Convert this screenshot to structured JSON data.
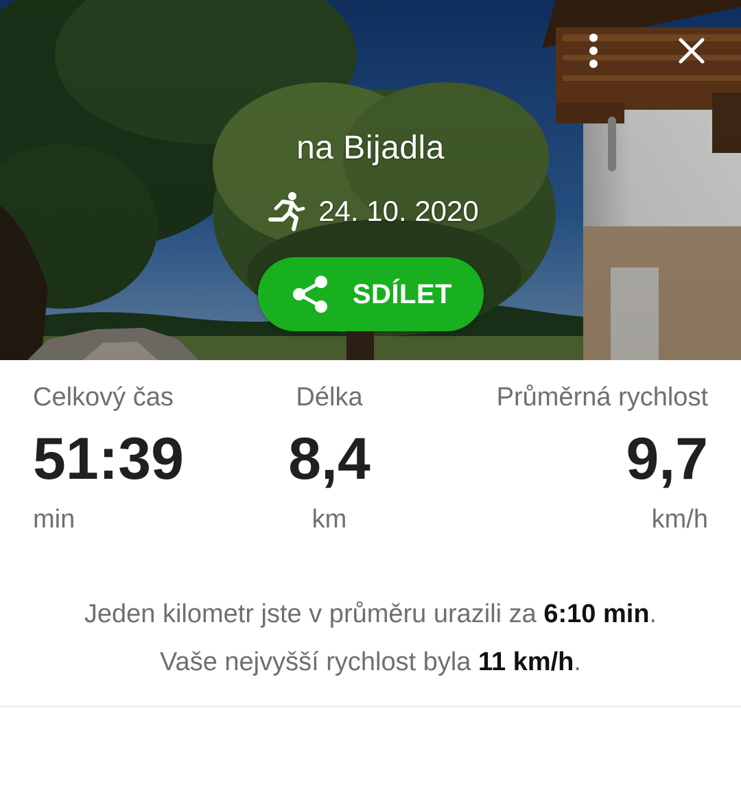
{
  "hero": {
    "title": "na Bijadla",
    "activity_icon": "running-person-icon",
    "date": "24. 10. 2020",
    "share_label": "SDÍLET",
    "menu_icon": "more-vert-icon",
    "close_icon": "close-icon"
  },
  "stats": {
    "total_time": {
      "label": "Celkový čas",
      "value": "51:39",
      "unit": "min"
    },
    "length": {
      "label": "Délka",
      "value": "8,4",
      "unit": "km"
    },
    "avg_speed": {
      "label": "Průměrná rychlost",
      "value": "9,7",
      "unit": "km/h"
    }
  },
  "summary": {
    "pace_prefix": "Jeden kilometr jste v průměru urazili za ",
    "pace_value": "6:10 min",
    "pace_suffix": ".",
    "max_prefix": "Vaše nejvyšší rychlost byla ",
    "max_value": "11 km/h",
    "max_suffix": "."
  },
  "colors": {
    "accent_green": "#19b01f",
    "text_primary": "#202020",
    "text_secondary": "#6f6f6f"
  }
}
